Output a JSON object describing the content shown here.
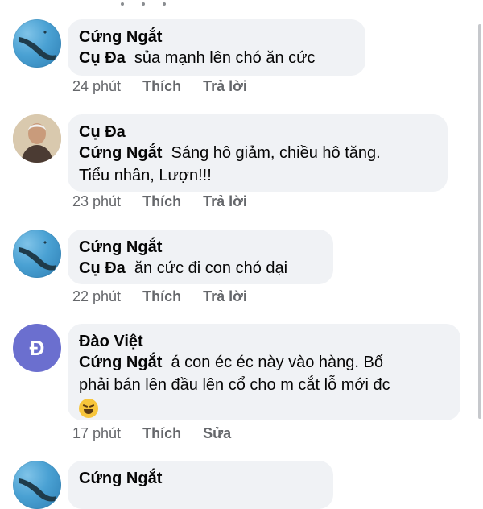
{
  "comments": [
    {
      "author": "Cứng Ngắt",
      "mention": "Cụ Đa",
      "text": "sủa mạnh lên chó ăn cức",
      "time": "24 phút",
      "like": "Thích",
      "reply": "Trả lời",
      "avatar": "map-avatar"
    },
    {
      "author": "Cụ Đa",
      "mention": "Cứng Ngắt",
      "text_line1": "Sáng hô giảm, chiều hô tăng.",
      "text_line2": "Tiểu nhân, Lượn!!!",
      "time": "23 phút",
      "like": "Thích",
      "reply": "Trả lời",
      "avatar": "photo-avatar"
    },
    {
      "author": "Cứng Ngắt",
      "mention": "Cụ Đa",
      "text": "ăn cức đi con chó dại",
      "time": "22 phút",
      "like": "Thích",
      "reply": "Trả lời",
      "avatar": "map-avatar"
    },
    {
      "author": "Đào Việt",
      "avatar_letter": "Đ",
      "mention": "Cứng Ngắt",
      "text_line1": "á con éc éc này vào hàng. Bố",
      "text_line2": "phải bán lên đầu lên cổ cho m cắt lỗ mới đc",
      "emoji": "rofl-emoji",
      "time": "17 phút",
      "like": "Thích",
      "edit": "Sửa"
    },
    {
      "author": "Cứng Ngắt",
      "avatar": "map-avatar"
    }
  ],
  "colors": {
    "bubble": "#f0f2f5",
    "meta": "#65676b",
    "text": "#050505",
    "letter_avatar": "#6b6fcf"
  }
}
